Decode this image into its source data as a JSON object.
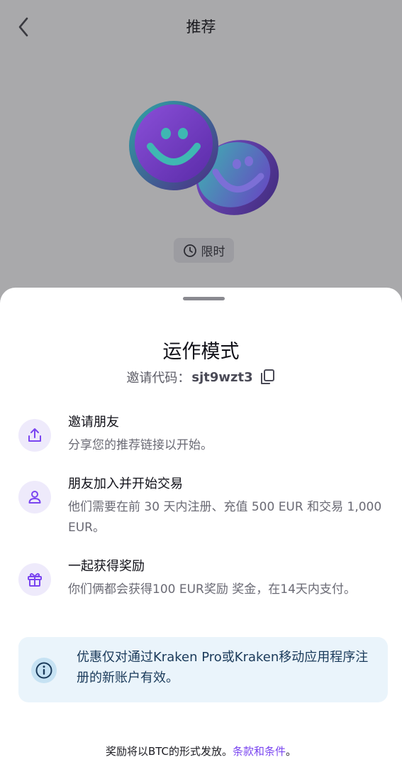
{
  "header": {
    "title": "推荐"
  },
  "badge": {
    "label": "限时"
  },
  "sheet": {
    "title": "运作模式",
    "invite_label": "邀请代码：",
    "invite_code": "sjt9wzt3"
  },
  "steps": [
    {
      "title": "邀请朋友",
      "desc": "分享您的推荐链接以开始。",
      "icon": "share-icon"
    },
    {
      "title": "朋友加入并开始交易",
      "desc": "他们需要在前 30 天内注册、充值 500 EUR 和交易 1,000 EUR。",
      "icon": "user-icon"
    },
    {
      "title": "一起获得奖励",
      "desc": "你们俩都会获得100 EUR奖励 奖金，在14天内支付。",
      "icon": "gift-icon"
    }
  ],
  "info": {
    "text": "优惠仅对通过Kraken Pro或Kraken移动应用程序注册的新账户有效。",
    "icon": "info-icon"
  },
  "footer": {
    "text": "奖励将以BTC的形式发放。",
    "link": "条款和条件",
    "suffix": "。"
  },
  "colors": {
    "accent": "#7a45f0",
    "overlay": "#a9a9ab",
    "info_bg": "#eaf4fb"
  }
}
